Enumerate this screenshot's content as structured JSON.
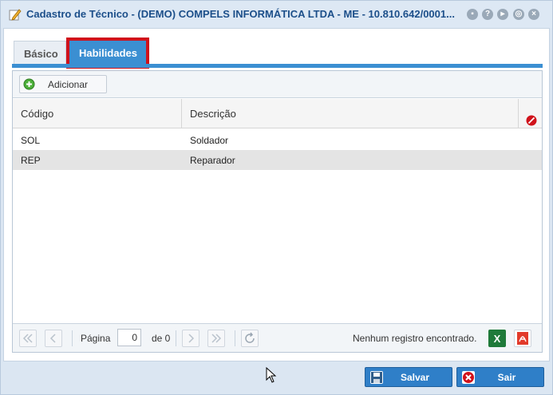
{
  "window": {
    "title": "Cadastro de Técnico - (DEMO) COMPELS INFORMÁTICA LTDA - ME - 10.810.642/0001..."
  },
  "tabs": [
    {
      "label": "Básico",
      "selected": false
    },
    {
      "label": "Habilidades",
      "selected": true
    }
  ],
  "toolbar": {
    "add_label": "Adicionar"
  },
  "grid": {
    "columns": [
      "Código",
      "Descrição"
    ],
    "rows": [
      {
        "codigo": "SOL",
        "descricao": "Soldador"
      },
      {
        "codigo": "REP",
        "descricao": "Reparador"
      }
    ]
  },
  "pager": {
    "page_label": "Página",
    "page_value": "0",
    "of_label": "de 0",
    "status": "Nenhum registro encontrado."
  },
  "footer": {
    "save_label": "Salvar",
    "exit_label": "Sair"
  },
  "colors": {
    "accent": "#3b8fd2",
    "highlight_border": "#d0121b",
    "title_text": "#1c4f8a"
  }
}
